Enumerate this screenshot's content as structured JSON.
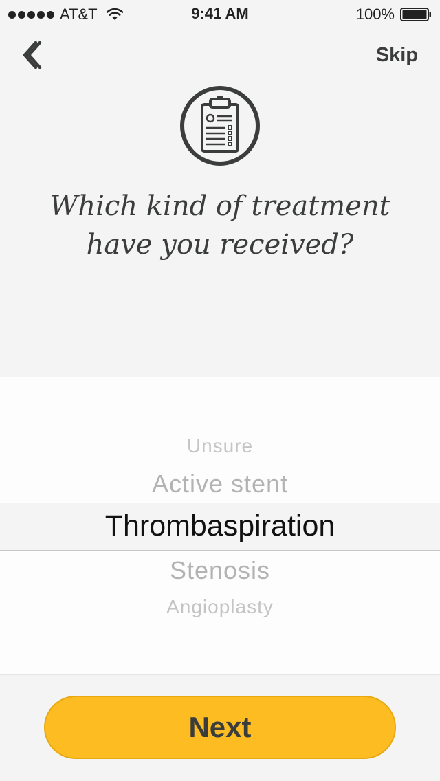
{
  "status_bar": {
    "carrier": "AT&T",
    "time": "9:41 AM",
    "battery": "100%",
    "signal_icon": "signal-dots-icon",
    "wifi_icon": "wifi-icon",
    "battery_icon": "battery-icon"
  },
  "nav": {
    "back_icon": "chevron-left-icon",
    "skip_label": "Skip"
  },
  "header": {
    "icon": "clipboard-icon",
    "question_line1": "Which kind of treatment",
    "question_line2": "have you received?"
  },
  "picker": {
    "options": [
      "Unsure",
      "Active stent",
      "Thrombaspiration",
      "Stenosis",
      "Angioplasty"
    ],
    "selected": "Thrombaspiration"
  },
  "footer": {
    "next_label": "Next"
  },
  "colors": {
    "background": "#f4f4f4",
    "accent": "#fdbc21",
    "text": "#3a3d3c"
  }
}
